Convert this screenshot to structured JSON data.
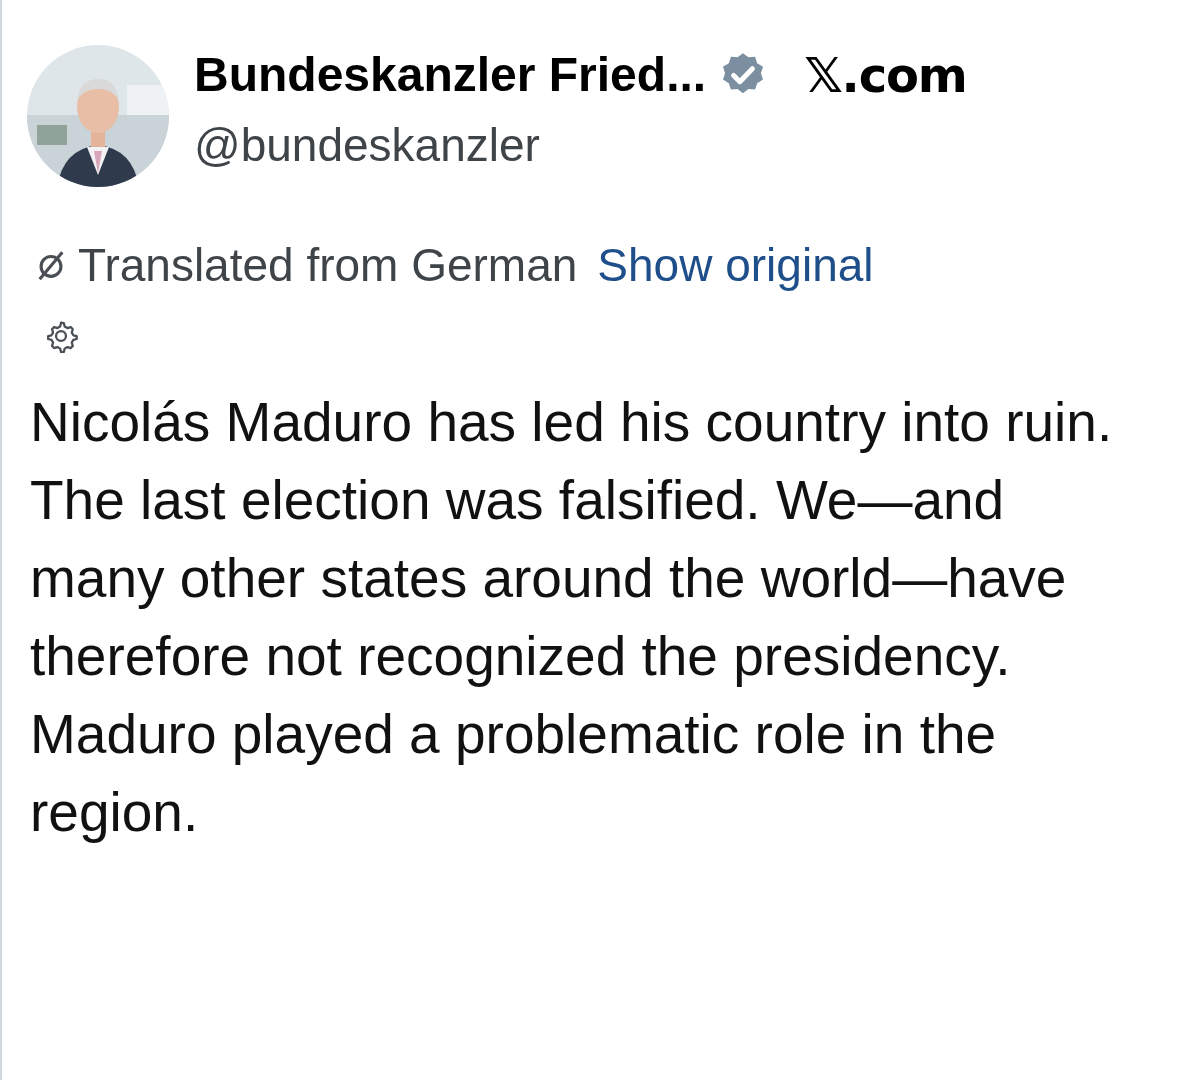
{
  "author": {
    "name": "Bundeskanzler Fried...",
    "verified": true,
    "handle": "@bundeskanzler"
  },
  "source": "𝕏.com",
  "translation": {
    "notice": "Translated from German",
    "link": "Show original"
  },
  "body": "Nicolás Maduro has led his country into ruin. The last election was falsified. We—and many other states around the world—have therefore not recognized the presidency. Maduro played a problematic role in the region."
}
